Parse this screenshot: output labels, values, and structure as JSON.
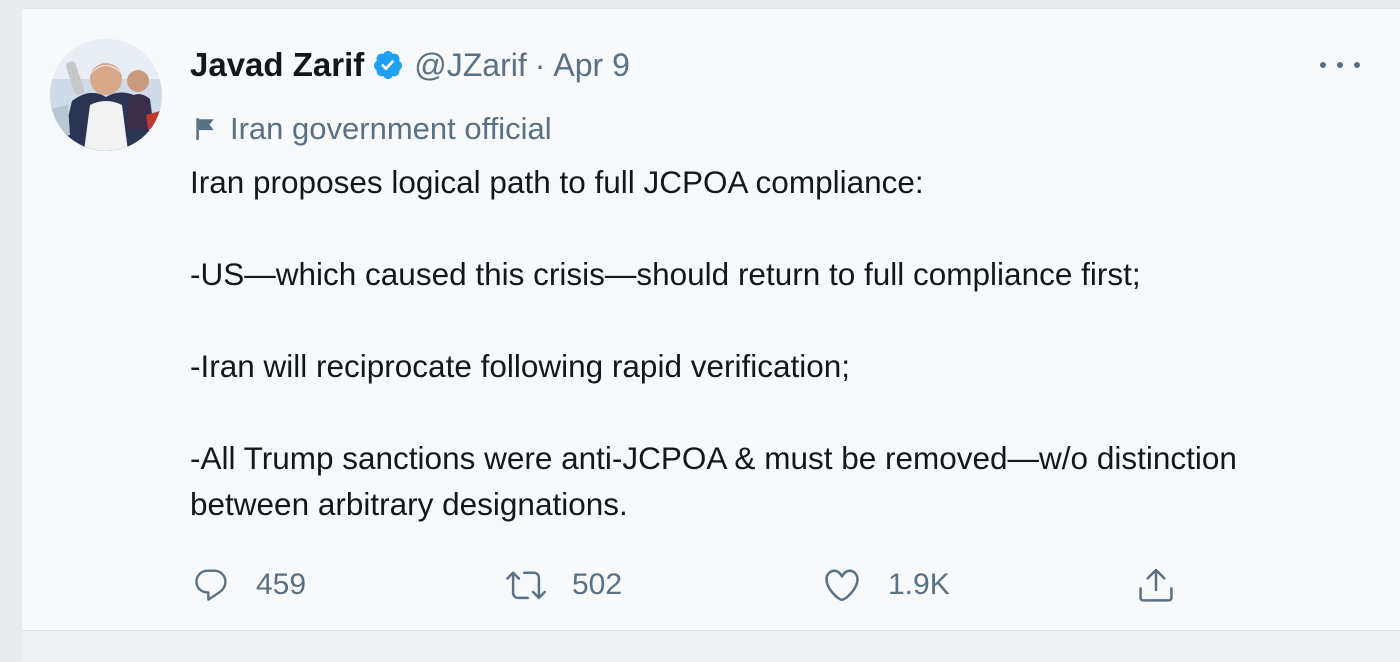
{
  "tweet": {
    "author": {
      "display_name": "Javad Zarif",
      "handle": "@JZarif",
      "verified": true
    },
    "separator": "·",
    "date": "Apr 9",
    "account_label": "Iran government official",
    "paragraphs": [
      "Iran proposes logical path to full JCPOA compliance:",
      "-US—which caused this crisis—should return to full compliance first;",
      "-Iran will reciprocate following rapid verification;",
      "-All Trump sanctions were anti-JCPOA & must be removed—w/o distinction between arbitrary designations."
    ],
    "actions": {
      "reply_count": "459",
      "retweet_count": "502",
      "like_count": "1.9K"
    }
  },
  "icons": {
    "verified": "verified-badge-icon",
    "label": "flag-icon",
    "more": "more-options-icon",
    "reply": "reply-icon",
    "retweet": "retweet-icon",
    "like": "heart-icon",
    "share": "share-icon"
  },
  "colors": {
    "accent": "#1da1f2",
    "muted_text": "#5b7083",
    "primary_text": "#14171a",
    "card_background": "#f7f9fa"
  }
}
